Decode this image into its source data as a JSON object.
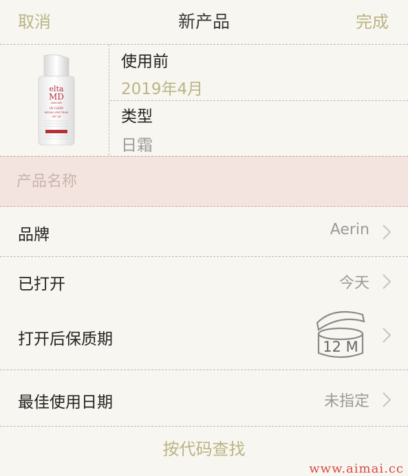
{
  "nav": {
    "cancel": "取消",
    "title": "新产品",
    "done": "完成"
  },
  "product": {
    "image_alt": "EltaMD UV Clear Broad-Spectrum SPF 46",
    "bottle_text": {
      "brand_line1": "elta",
      "brand_line2": "MD",
      "sub": "SKINCARE",
      "product_line1": "UV CLEAR",
      "product_line2": "BROAD-SPECTRUM",
      "product_line3": "SPF 46"
    },
    "use_before_label": "使用前",
    "use_before_value": "2019年4月",
    "type_label": "类型",
    "type_value": "日霜"
  },
  "name_field": {
    "placeholder": "产品名称",
    "value": ""
  },
  "rows": {
    "brand": {
      "label": "品牌",
      "value": "Aerin"
    },
    "opened": {
      "label": "已打开",
      "value": "今天"
    },
    "pao": {
      "label": "打开后保质期",
      "value": "12 M"
    },
    "best_by": {
      "label": "最佳使用日期",
      "value": "未指定"
    }
  },
  "barcode_link": "按代码查找",
  "watermark": "www.aimai.cc",
  "colors": {
    "accent": "#b9b585",
    "name_row_bg": "#f4e4df",
    "background": "#f8f6f0"
  }
}
